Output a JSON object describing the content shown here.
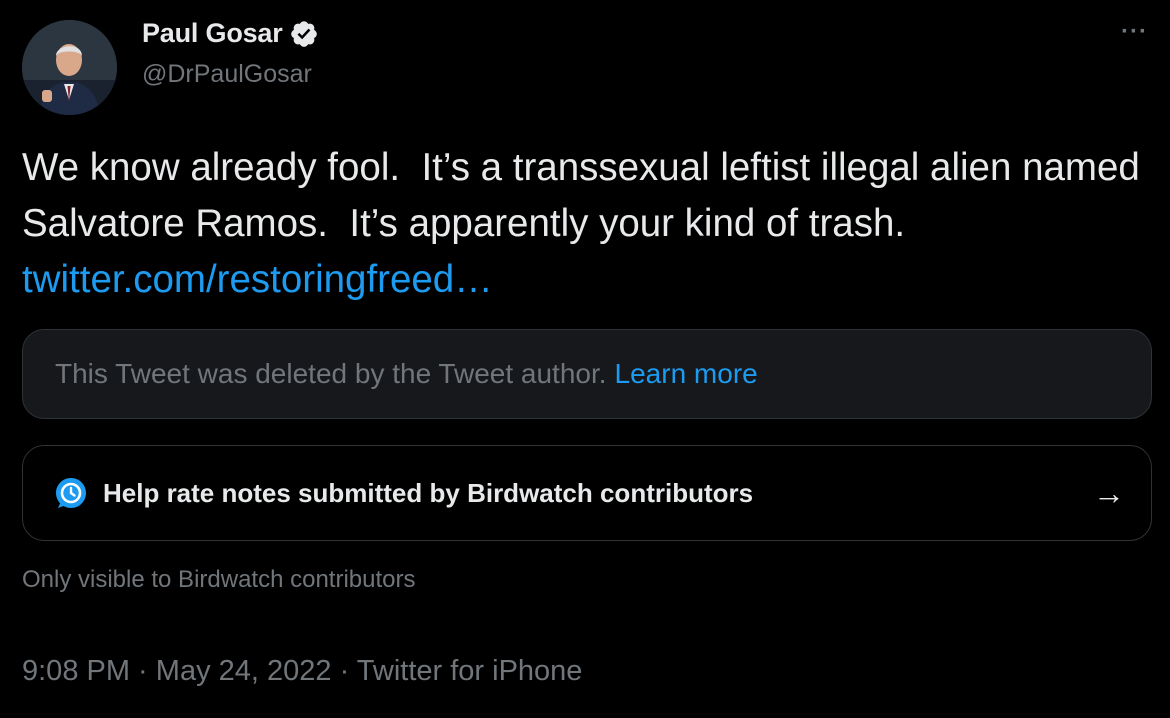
{
  "author": {
    "name": "Paul Gosar",
    "handle": "@DrPaulGosar",
    "avatar_icon": "profile-photo",
    "verified_icon": "verified-badge-icon"
  },
  "more_label": "···",
  "tweet": {
    "text": "We know already fool.  It’s a transsexual leftist illegal alien named Salvatore Ramos.  It’s apparently your kind of trash. ",
    "link": "twitter.com/restoringfreed…"
  },
  "quoted": {
    "deleted_text": "This Tweet was deleted by the Tweet author.",
    "learn_more": "Learn more"
  },
  "birdwatch": {
    "icon": "birdwatch-icon",
    "label": "Help rate notes submitted by Birdwatch contributors",
    "arrow": "→",
    "note": "Only visible to Birdwatch contributors"
  },
  "meta": {
    "time": "9:08 PM",
    "date": "May 24, 2022",
    "source": "Twitter for iPhone",
    "separator": " · "
  },
  "colors": {
    "background": "#000000",
    "text": "#e7e9ea",
    "secondary": "#71767b",
    "link": "#1d9bf0",
    "border": "#2f3336",
    "card": "#16181c"
  }
}
